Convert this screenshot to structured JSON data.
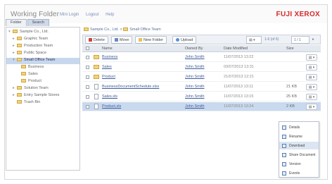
{
  "header": {
    "app_title": "Working Folder",
    "links": [
      "Mini Login",
      "Logout",
      "Help"
    ],
    "brand": "FUJI XEROX"
  },
  "tabs": [
    {
      "label": "Folder",
      "active": false
    },
    {
      "label": "Search",
      "active": true
    }
  ],
  "sidebar": {
    "items": [
      {
        "label": "Sample Co., Ltd.",
        "depth": 0,
        "selected": false
      },
      {
        "label": "Graphic Team",
        "depth": 1,
        "selected": false
      },
      {
        "label": "Production Team",
        "depth": 1,
        "selected": false
      },
      {
        "label": "Public Space",
        "depth": 1,
        "selected": false
      },
      {
        "label": "Small Office Team",
        "depth": 1,
        "selected": true
      },
      {
        "label": "Business",
        "depth": 2,
        "selected": false
      },
      {
        "label": "Sales",
        "depth": 2,
        "selected": false
      },
      {
        "label": "Product",
        "depth": 2,
        "selected": false
      },
      {
        "label": "Solution Team",
        "depth": 1,
        "selected": false
      },
      {
        "label": "Entry Sample Stores",
        "depth": 1,
        "selected": false
      },
      {
        "label": "Trash Bin",
        "depth": 1,
        "selected": false
      }
    ]
  },
  "breadcrumb": [
    "Sample Co., Ltd.",
    "Small Office Team"
  ],
  "toolbar": {
    "delete_label": "Delete",
    "move_label": "Move",
    "new_folder_label": "New Folder",
    "upload_label": "Upload",
    "view_label": "▤ ▾",
    "pager_text": "1-6 (of 6)",
    "page_box": "1 / 1",
    "next_label": "▸"
  },
  "columns": {
    "name": "Name",
    "owner": "Owned By",
    "date": "Date Modified",
    "size": "Size"
  },
  "rows": [
    {
      "type": "folder",
      "name": "Business",
      "owner": "John Smith",
      "date": "11/07/2013 13:22",
      "size": "",
      "selected": false
    },
    {
      "type": "folder",
      "name": "Sales",
      "owner": "John Smith",
      "date": "03/07/2013 13:31",
      "size": "",
      "selected": false
    },
    {
      "type": "folder",
      "name": "Product",
      "owner": "John Smith",
      "date": "21/07/2013 12:21",
      "size": "",
      "selected": false
    },
    {
      "type": "doc",
      "name": "BusinessDocumentSchedule.xlsx",
      "owner": "John Smith",
      "date": "11/07/2013 13:11",
      "size": "21 KB",
      "selected": false
    },
    {
      "type": "doc",
      "name": "Sales.xls",
      "owner": "John Smith",
      "date": "11/07/2013 13:15",
      "size": "25 KB",
      "selected": false
    },
    {
      "type": "doc",
      "name": "Product.xls",
      "owner": "John Smith",
      "date": "11/07/2013 13:24",
      "size": "2 KB",
      "selected": true
    }
  ],
  "row_action_label": "▤ ▾",
  "context_menu": {
    "items": [
      {
        "label": "Details",
        "highlighted": false
      },
      {
        "label": "Rename",
        "highlighted": false
      },
      {
        "label": "Download",
        "highlighted": true
      },
      {
        "label": "Share Document",
        "highlighted": false
      },
      {
        "label": "Version",
        "highlighted": false
      },
      {
        "label": "Events",
        "highlighted": false
      }
    ]
  }
}
